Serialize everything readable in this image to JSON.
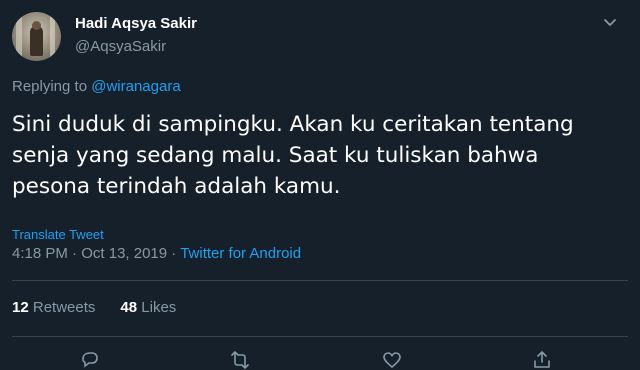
{
  "author": {
    "name": "Hadi Aqsya Sakir",
    "handle": "@AqsyaSakir"
  },
  "reply": {
    "prefix": "Replying to",
    "mention": "@wiranagara"
  },
  "tweet": {
    "text": "Sini duduk di sampingku. Akan ku ceritakan tentang senja yang sedang malu. Saat ku tuliskan bahwa pesona terindah adalah kamu."
  },
  "translate_label": "Translate Tweet",
  "meta": {
    "time": "4:18 PM",
    "separator": "·",
    "date": "Oct 13, 2019",
    "source": "Twitter for Android"
  },
  "stats": {
    "retweets_count": "12",
    "retweets_label": "Retweets",
    "likes_count": "48",
    "likes_label": "Likes"
  },
  "colors": {
    "background": "#15202b",
    "accent": "#1da1f2",
    "muted": "#8899a6",
    "divider": "#38444d"
  },
  "icons": [
    "chevron-down-icon",
    "reply-icon",
    "retweet-icon",
    "like-icon",
    "share-icon"
  ]
}
